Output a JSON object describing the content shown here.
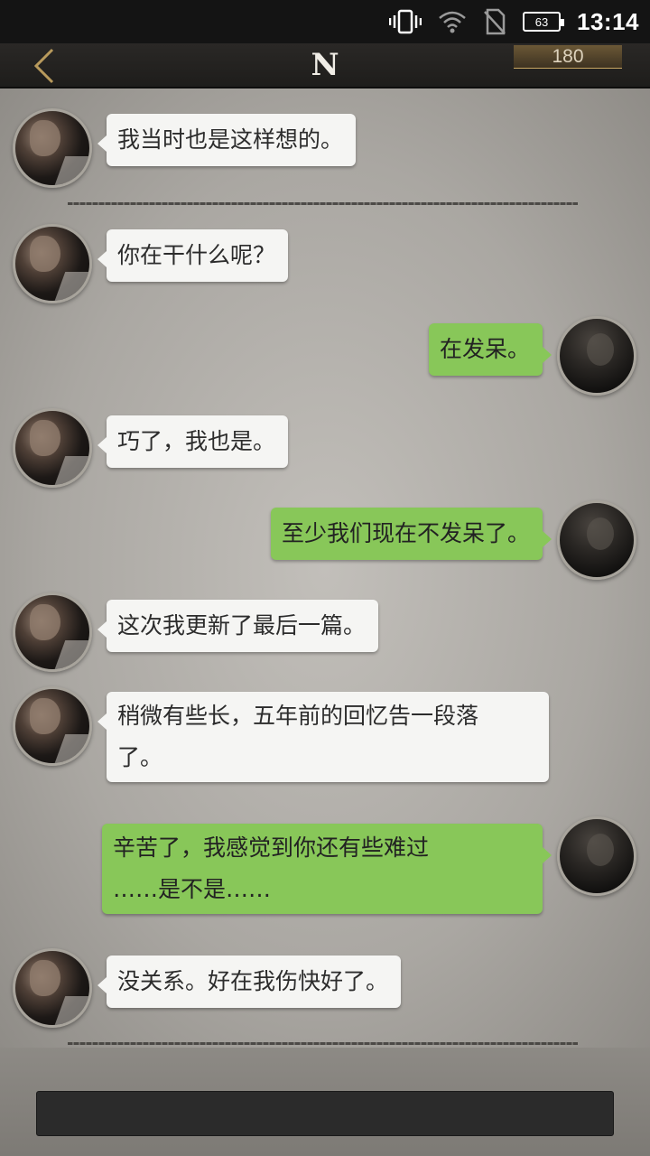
{
  "status_bar": {
    "time": "13:14",
    "battery": "63",
    "icons": [
      "vibrate-icon",
      "wifi-icon",
      "no-sim-icon",
      "battery-icon"
    ]
  },
  "app_bar": {
    "logo": "N",
    "counter": "180",
    "back_icon": "chevron-left-icon"
  },
  "messages": [
    {
      "from": "friend",
      "text": "我当时也是这样想的。"
    },
    {
      "from": "friend",
      "text": "你在干什么呢？"
    },
    {
      "from": "me",
      "text": "在发呆。"
    },
    {
      "from": "friend",
      "text": "巧了，我也是。"
    },
    {
      "from": "me",
      "text": "至少我们现在不发呆了。"
    },
    {
      "from": "friend",
      "text": "这次我更新了最后一篇。"
    },
    {
      "from": "friend",
      "line1": "稍微有些长，五年前的回忆告一段落",
      "line2": "了。"
    },
    {
      "from": "me",
      "line1": "辛苦了，我感觉到你还有些难过",
      "line2": "……是不是……"
    },
    {
      "from": "friend",
      "text": "没关系。好在我伤快好了。"
    }
  ],
  "input": {
    "value": "",
    "placeholder": ""
  },
  "colors": {
    "friend_bubble": "#f5f5f3",
    "me_bubble": "#88c759",
    "counter_accent": "#c8a763"
  }
}
